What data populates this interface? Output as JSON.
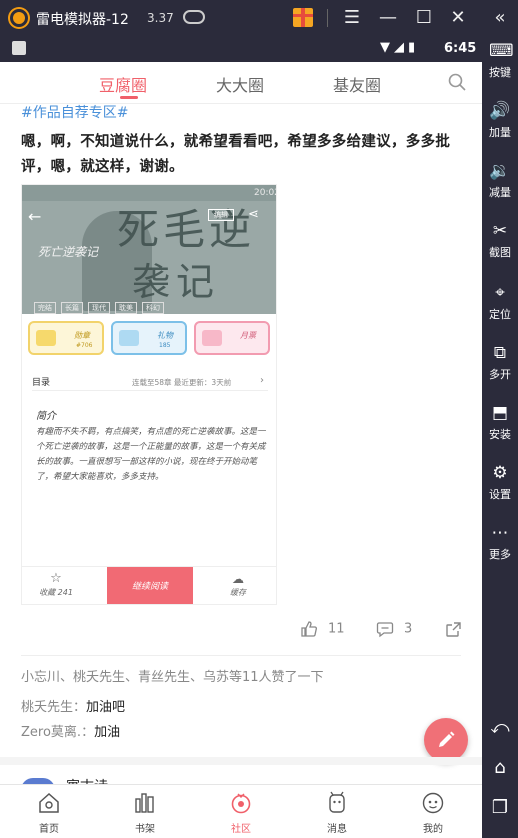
{
  "emulator": {
    "title": "雷电模拟器-12",
    "version": "3.37",
    "controls": {
      "menu": "☰",
      "minimize": "—",
      "maximize": "☐",
      "close": "✕"
    },
    "sidebar": {
      "collapse": "«",
      "items": [
        {
          "label": "按键",
          "icon": "keyboard-icon"
        },
        {
          "label": "加量",
          "icon": "volume-up-icon"
        },
        {
          "label": "减量",
          "icon": "volume-down-icon"
        },
        {
          "label": "截图",
          "icon": "scissors-icon"
        },
        {
          "label": "定位",
          "icon": "location-icon"
        },
        {
          "label": "多开",
          "icon": "multi-open-icon"
        },
        {
          "label": "安装",
          "icon": "apk-install-icon"
        },
        {
          "label": "设置",
          "icon": "gear-icon"
        },
        {
          "label": "更多",
          "icon": "more-icon"
        }
      ]
    }
  },
  "statusbar": {
    "time": "6:45"
  },
  "header": {
    "tabs": [
      {
        "label": "豆腐圈",
        "active": true
      },
      {
        "label": "大大圈",
        "active": false
      },
      {
        "label": "基友圈",
        "active": false
      }
    ]
  },
  "post": {
    "tag": "#作品自荐专区#",
    "body": "嗯，啊，不知道说什么，就希望看看吧，希望多多给建议，多多批评，嗯，就这样，谢谢。",
    "image": {
      "status_time": "20:02",
      "edit_label": "编辑",
      "book_name": "死亡逆袭记",
      "title_big": "死毛逆",
      "title_big2": "袭记",
      "chips": [
        "完结",
        "长篇",
        "现代",
        "耽美",
        "科幻"
      ],
      "cards": [
        {
          "label": "勋章",
          "num": "#706"
        },
        {
          "label": "礼物",
          "num": "185"
        },
        {
          "label": "月票",
          "num": ""
        }
      ],
      "dir_label": "目录",
      "dir_info": "连载至58章 最近更新：3天前",
      "intro_title": "简介",
      "intro_text": "有趣而不失不羁，有点搞笑，有点虐的死亡逆袭故事。这是一个死亡逆袭的故事，这是一个正能量的故事，这是一个有关成长的故事。一直很想写一部这样的小说，现在终于开始动笔了，希望大家能喜欢，多多支持。",
      "fav_label": "收藏 241",
      "read_label": "继续阅读",
      "cache_label": "缓存"
    },
    "likes": "11",
    "comments_count": "3",
    "likers": "小忘川、桃夭先生、青丝先生、乌苏等11人赞了一下",
    "comments": [
      {
        "author": "桃夭先生",
        "text": "加油吧"
      },
      {
        "author": "Zero莫离.",
        "text": "加油"
      }
    ],
    "next_author": "寓古诗"
  },
  "bottom_nav": [
    {
      "label": "首页",
      "icon": "home-icon",
      "active": false
    },
    {
      "label": "书架",
      "icon": "bookshelf-icon",
      "active": false
    },
    {
      "label": "社区",
      "icon": "community-icon",
      "active": true
    },
    {
      "label": "消息",
      "icon": "message-icon",
      "active": false
    },
    {
      "label": "我的",
      "icon": "profile-icon",
      "active": false
    }
  ],
  "colors": {
    "accent": "#f0606a",
    "tag": "#4a90d9",
    "emulator_chrome": "#2b2b3b"
  }
}
